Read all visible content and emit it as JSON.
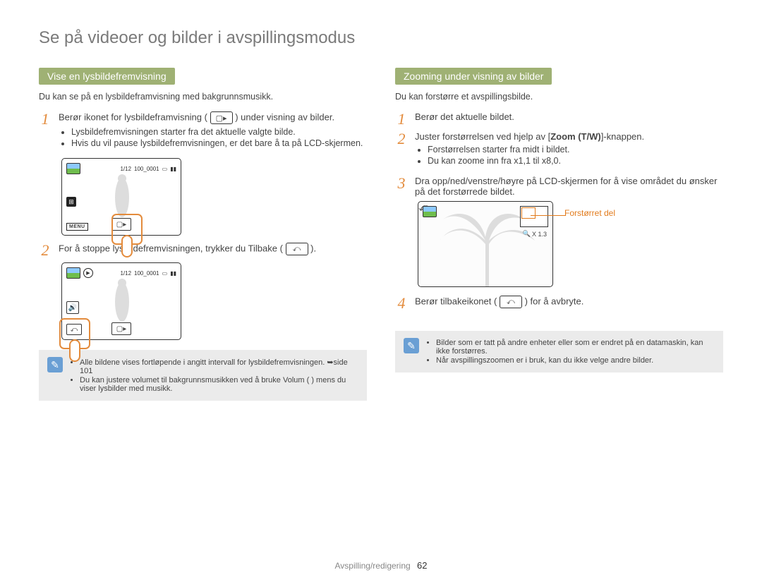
{
  "title": "Se på videoer og bilder i avspillingsmodus",
  "left": {
    "header": "Vise en lysbildefremvisning",
    "intro": "Du kan se på en lysbildeframvisning med bakgrunnsmusikk.",
    "steps": [
      {
        "n": "1",
        "text_pre": "Berør ikonet for lysbildeframvisning ( ",
        "text_post": " ) under visning av bilder.",
        "bullets": [
          "Lysbildefremvisningen starter fra det aktuelle valgte bilde.",
          "Hvis du vil pause lysbildefremvisningen, er det bare å ta på LCD-skjermen."
        ]
      },
      {
        "n": "2",
        "text_pre": "For å stoppe lysbildefremvisningen, trykker du Tilbake ( ",
        "text_post": " )."
      }
    ],
    "note": [
      "Alle bildene vises fortløpende i angitt intervall for lysbildefremvisningen. ➥side 101",
      "Du kan justere volumet til bakgrunnsmusikken ved å bruke Volum (    ) mens du viser lysbilder med musikk."
    ],
    "thumb1": {
      "counter": "1/12",
      "folder": "100_0001",
      "menu": "MENU"
    },
    "thumb2": {
      "counter": "1/12",
      "folder": "100_0001"
    }
  },
  "right": {
    "header": "Zooming under visning av bilder",
    "intro": "Du kan forstørre et avspillingsbilde.",
    "steps": [
      {
        "n": "1",
        "text": "Berør det aktuelle bildet."
      },
      {
        "n": "2",
        "text_pre": "Juster forstørrelsen ved hjelp av [",
        "text_bold": "Zoom (T/W)",
        "text_post": "]-knappen.",
        "bullets": [
          "Forstørrelsen starter fra midt i bildet.",
          "Du kan zoome inn fra x1,1 til x8,0."
        ]
      },
      {
        "n": "3",
        "text": "Dra opp/ned/venstre/høyre på LCD-skjermen for å vise området du ønsker på det forstørrede bildet."
      },
      {
        "n": "4",
        "text_pre": "Berør tilbakeikonet ( ",
        "text_post": " ) for å avbryte."
      }
    ],
    "zoom_callout": "Forstørret del",
    "zoom_label": "X 1.3",
    "note": [
      "Bilder som er tatt på andre enheter eller som er endret på en datamaskin, kan ikke forstørres.",
      "Når avspillingszoomen er i bruk, kan du ikke velge andre bilder."
    ]
  },
  "footer": {
    "section": "Avspilling/redigering",
    "page": "62"
  }
}
